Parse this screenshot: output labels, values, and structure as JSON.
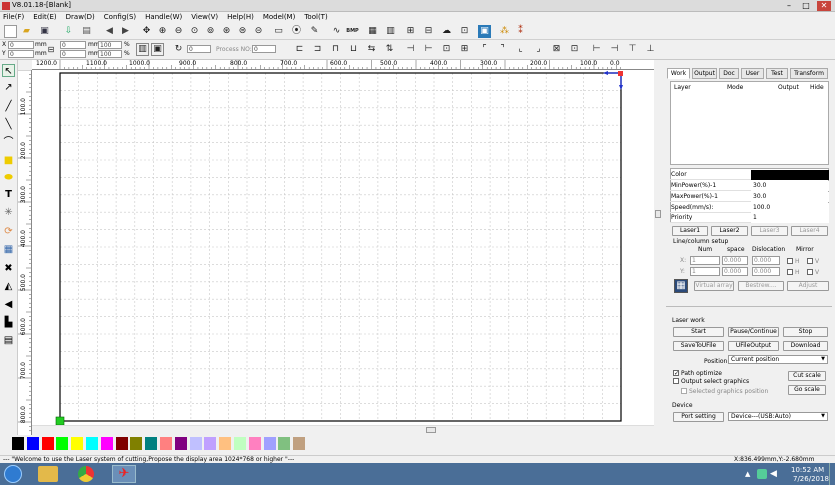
{
  "window": {
    "title": "V8.01.18-[Blank]",
    "minimize": "–",
    "maximize": "□",
    "close": "✕"
  },
  "menu": [
    "File(F)",
    "Edit(E)",
    "Draw(D)",
    "Config(S)",
    "Handle(W)",
    "View(V)",
    "Help(H)",
    "Model(M)",
    "Tool(T)"
  ],
  "toolbar": {
    "x_label": "X",
    "y_label": "Y",
    "x_value": "0",
    "y_value": "0",
    "x_unit": "mm",
    "y_unit": "mm",
    "w_value": "0",
    "h_value": "0",
    "w_unit": "mm",
    "h_unit": "mm",
    "wp_value": "100",
    "hp_value": "100",
    "pct": "%",
    "rotate_value": "0",
    "process_no_label": "Process NO:",
    "process_no_value": "0",
    "bmp_label": "BMP"
  },
  "ruler": {
    "h_ticks": [
      "1200.0",
      "1100.0",
      "1000.0",
      "900.0",
      "800.0",
      "700.0",
      "600.0",
      "500.0",
      "400.0",
      "300.0",
      "200.0",
      "100.0",
      "0.0"
    ],
    "v_ticks": [
      "100.0",
      "200.0",
      "300.0",
      "400.0",
      "500.0",
      "600.0",
      "700.0",
      "800.0"
    ]
  },
  "palette": [
    "#000000",
    "#0000ff",
    "#ff0000",
    "#00ff00",
    "#ffff00",
    "#00ffff",
    "#ff00ff",
    "#800000",
    "#808000",
    "#008080",
    "#ff8080",
    "#800080",
    "#c0c0ff",
    "#c0a0ff",
    "#ffc080",
    "#c0ffc0",
    "#ff80c0",
    "#a0a0ff",
    "#80c080",
    "#c0a080"
  ],
  "panel": {
    "tabs": [
      "Work",
      "Output",
      "Doc",
      "User",
      "Test",
      "Transform"
    ],
    "layer_table": {
      "headers": [
        "Layer",
        "Mode",
        "Output",
        "Hide"
      ]
    },
    "props": [
      {
        "key": "Color",
        "value": ""
      },
      {
        "key": "MinPower(%)-1",
        "value": "30.0"
      },
      {
        "key": "MaxPower(%)-1",
        "value": "30.0"
      },
      {
        "key": "Speed(mm/s):",
        "value": "100.0"
      },
      {
        "key": "Priority",
        "value": "1"
      }
    ],
    "laser_buttons": [
      "Laser1",
      "Laser2",
      "Laser3",
      "Laser4"
    ],
    "line_col": {
      "title": "Line/column setup",
      "headers": [
        "Num",
        "space",
        "Dislocation",
        "Mirror"
      ],
      "x_label": "X:",
      "y_label": "Y:",
      "x_num": "1",
      "x_space": "0.000",
      "x_disl": "0.000",
      "y_num": "1",
      "y_space": "0.000",
      "y_disl": "0.000",
      "mirror_h": "H",
      "mirror_v": "V"
    },
    "array_buttons": [
      "Virtual array",
      "Bestrew....",
      "Adjust"
    ],
    "laser_work_title": "Laser work",
    "work_buttons": [
      "Start",
      "Pause/Continue",
      "Stop",
      "SaveToUFile",
      "UFileOutput",
      "Download"
    ],
    "position_label": "Position:",
    "position_value": "Current position",
    "path_optimize": "Path optimize",
    "output_select": "Output select graphics",
    "selected_pos": "Selected graphics position",
    "cut_scale": "Cut scale",
    "go_scale": "Go scale",
    "device_title": "Device",
    "port_setting": "Port setting",
    "device_value": "Device---(USB:Auto)"
  },
  "status": {
    "message": "--- \"Welcome to use the Laser system of cutting,Propose the display area 1024*768 or higher \"---",
    "coords": "X:836.499mm,Y:-2.680mm"
  },
  "clock": {
    "time": "10:52 AM",
    "date": "7/26/2018"
  }
}
